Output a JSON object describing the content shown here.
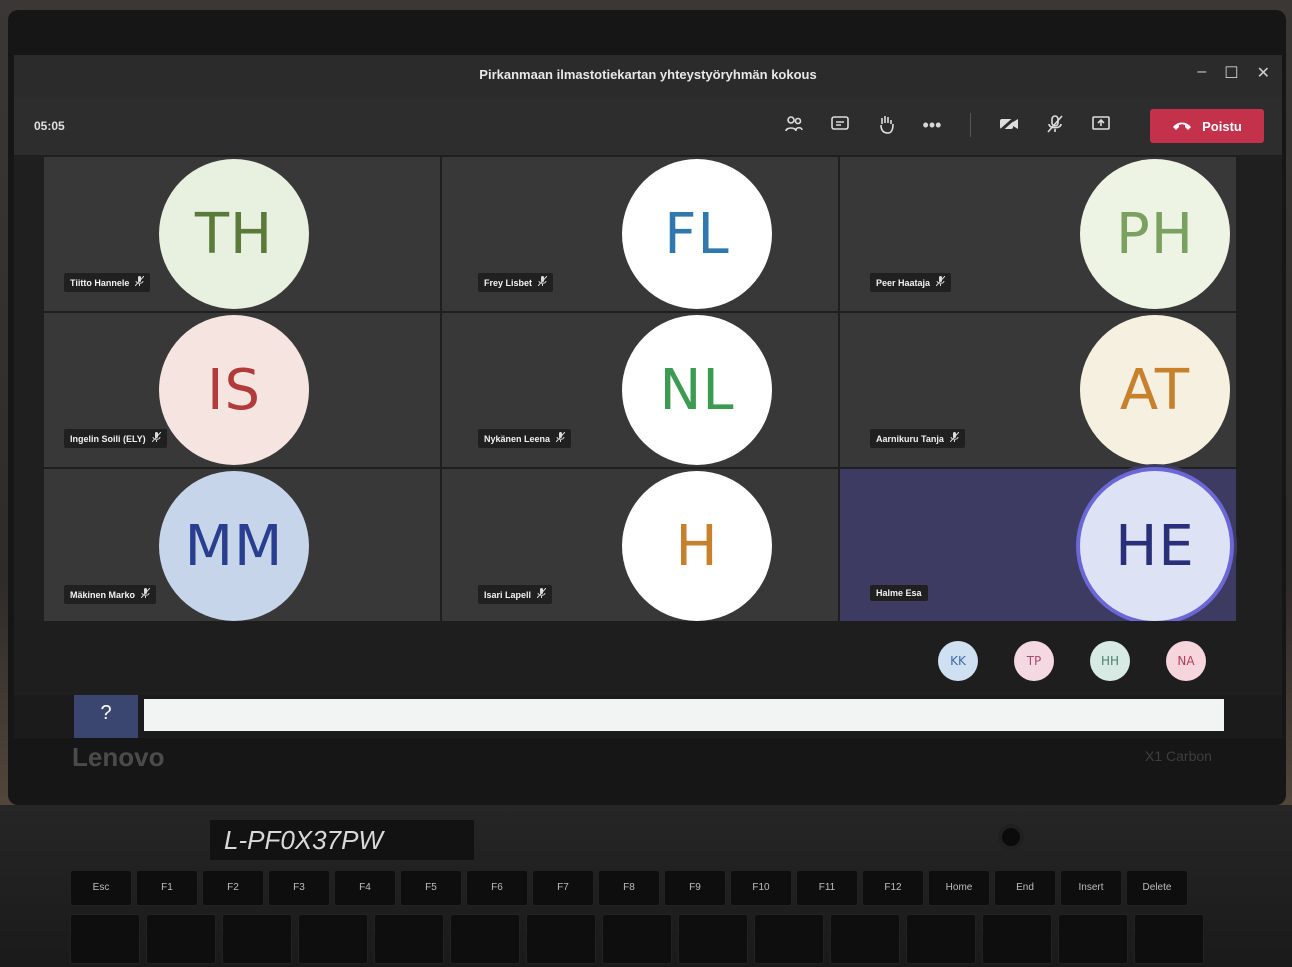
{
  "window": {
    "title": "Pirkanmaan ilmastotiekartan yhteystyöryhmän kokous"
  },
  "toolbar": {
    "timer": "05:05",
    "leave_label": "Poistu"
  },
  "participants": [
    {
      "initials": "TH",
      "name": "Tiitto Hannele",
      "text_color": "#5b7a3a",
      "bg": "#e8f0e0"
    },
    {
      "initials": "FL",
      "name": "Frey Lisbet",
      "text_color": "#2f78ad",
      "bg": "#ffffff"
    },
    {
      "initials": "PH",
      "name": "Peer Haataja",
      "text_color": "#7aa160",
      "bg": "#eef4e4"
    },
    {
      "initials": "IS",
      "name": "Ingelin Soili (ELY)",
      "text_color": "#b13a3a",
      "bg": "#f6e4e0"
    },
    {
      "initials": "NL",
      "name": "Nykänen Leena",
      "text_color": "#3c9a52",
      "bg": "#ffffff"
    },
    {
      "initials": "AT",
      "name": "Aarnikuru Tanja",
      "text_color": "#c7812c",
      "bg": "#f6f0e0"
    },
    {
      "initials": "MM",
      "name": "Mäkinen Marko",
      "text_color": "#2a3e8f",
      "bg": "#c6d5ea"
    },
    {
      "initials": "H",
      "name": "Isari Lapell",
      "text_color": "#c7812c",
      "bg": "#ffffff"
    },
    {
      "initials": "HE",
      "name": "Halme Esa",
      "text_color": "#2a2f7a",
      "bg": "#dde3f4"
    }
  ],
  "overflow_participants": [
    {
      "initials": "KK",
      "text_color": "#3c6aa6",
      "bg": "#cfe0f3"
    },
    {
      "initials": "TP",
      "text_color": "#b04a6a",
      "bg": "#f5d9e2"
    },
    {
      "initials": "HH",
      "text_color": "#4f7f6f",
      "bg": "#d7eae3"
    },
    {
      "initials": "NA",
      "text_color": "#b0405a",
      "bg": "#f6d5dd"
    }
  ],
  "icons": {
    "participants": "people-icon",
    "chat": "chat-icon",
    "raise_hand": "hand-icon",
    "more": "more-icon",
    "camera": "camera-off-icon",
    "mic": "mic-off-icon",
    "share": "share-screen-icon",
    "leave": "phone-hangup-icon",
    "help": "help-icon"
  },
  "laptop": {
    "brand": "Lenovo",
    "model": "X1 Carbon",
    "asset_tag": "L-PF0X37PW"
  },
  "keyboard": {
    "fn_row": [
      "Esc",
      "F1",
      "F2",
      "F3",
      "F4",
      "F5",
      "F6",
      "F7",
      "F8",
      "F9",
      "F10",
      "F11",
      "F12",
      "Home",
      "End",
      "Insert",
      "Delete"
    ]
  }
}
